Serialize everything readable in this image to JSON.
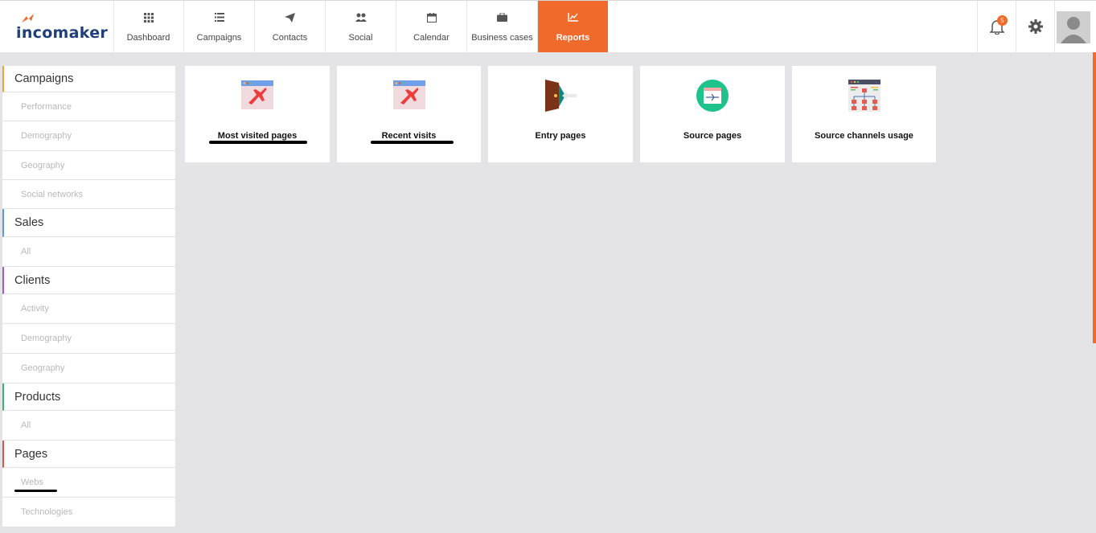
{
  "brand": {
    "name": "incomaker",
    "accent": "#ef6a2b",
    "logo_color": "#1f3f7a"
  },
  "nav": [
    {
      "label": "Dashboard",
      "icon": "grid-icon"
    },
    {
      "label": "Campaigns",
      "icon": "list-icon"
    },
    {
      "label": "Contacts",
      "icon": "paper-plane-icon"
    },
    {
      "label": "Social",
      "icon": "users-icon"
    },
    {
      "label": "Calendar",
      "icon": "calendar-icon"
    },
    {
      "label": "Business cases",
      "icon": "briefcase-icon"
    },
    {
      "label": "Reports",
      "icon": "line-chart-icon",
      "active": true
    }
  ],
  "header_right": {
    "notifications_count": "5"
  },
  "sidebar": {
    "sections": [
      {
        "label": "Campaigns",
        "color": "#f0a23a",
        "items": [
          "Performance",
          "Demography",
          "Geography",
          "Social networks"
        ]
      },
      {
        "label": "Sales",
        "color": "#5b9bd5",
        "items": [
          "All"
        ]
      },
      {
        "label": "Clients",
        "color": "#a05bc8",
        "items": [
          "Activity",
          "Demography",
          "Geography"
        ]
      },
      {
        "label": "Products",
        "color": "#3cb371",
        "items": [
          "All"
        ]
      },
      {
        "label": "Pages",
        "color": "#d9534f",
        "items": [
          "Webs",
          "Technologies"
        ]
      }
    ]
  },
  "cards": [
    {
      "label": "Most visited pages",
      "icon": "browser-plane-icon"
    },
    {
      "label": "Recent visits",
      "icon": "browser-plane-icon"
    },
    {
      "label": "Entry pages",
      "icon": "door-entry-icon"
    },
    {
      "label": "Source pages",
      "icon": "source-page-icon"
    },
    {
      "label": "Source channels usage",
      "icon": "sitemap-icon"
    }
  ]
}
